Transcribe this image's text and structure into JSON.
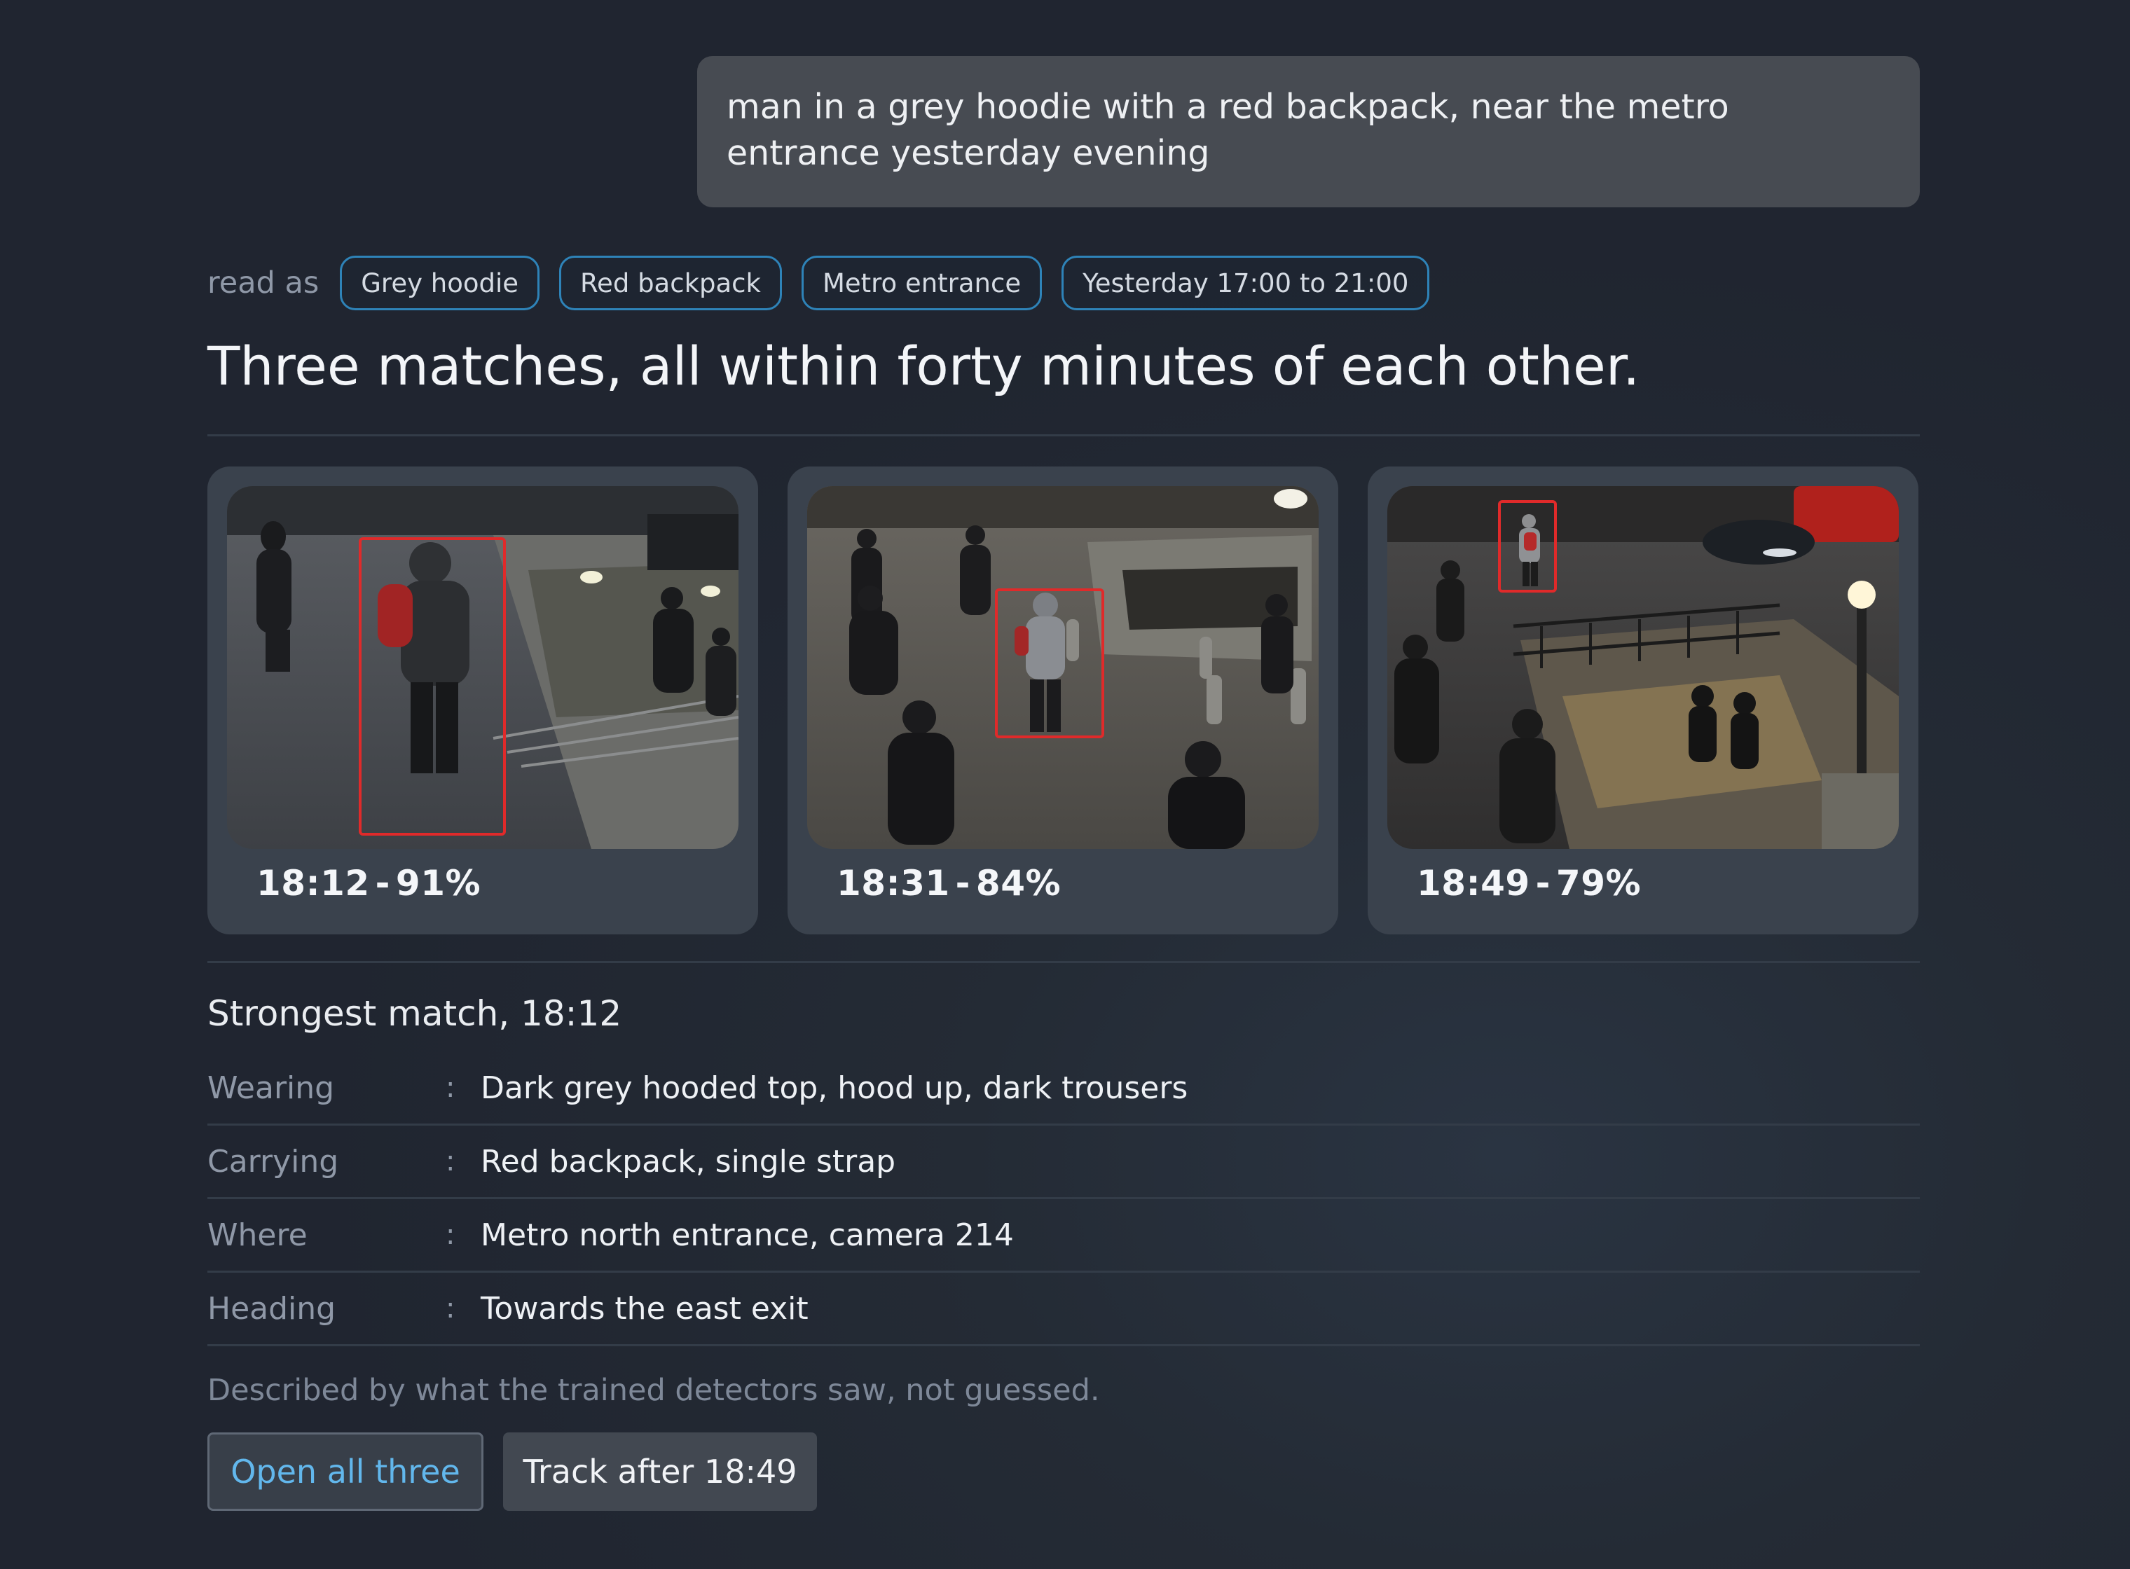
{
  "query": {
    "text": "man in a grey hoodie with a red backpack, near the metro entrance yesterday evening"
  },
  "interpretation": {
    "label": "read as",
    "chips": [
      "Grey hoodie",
      "Red backpack",
      "Metro entrance",
      "Yesterday 17:00 to 21:00"
    ]
  },
  "headline": "Three matches, all within forty minutes of each other.",
  "matches": [
    {
      "time": "18:12",
      "confidence": "91%"
    },
    {
      "time": "18:31",
      "confidence": "84%"
    },
    {
      "time": "18:49",
      "confidence": "79%"
    }
  ],
  "caption_separator": "-",
  "detail": {
    "title": "Strongest match, 18:12",
    "rows": [
      {
        "label": "Wearing",
        "value": "Dark grey hooded top, hood up, dark trousers"
      },
      {
        "label": "Carrying",
        "value": "Red backpack, single strap"
      },
      {
        "label": "Where",
        "value": "Metro north entrance, camera 214"
      },
      {
        "label": "Heading",
        "value": "Towards the east exit"
      }
    ],
    "separator": ":"
  },
  "footnote": "Described by what the trained detectors saw, not guessed.",
  "actions": {
    "open_label": "Open all three",
    "track_label": "Track after 18:49"
  },
  "colors": {
    "accent": "#2e83b8",
    "link": "#62b7ec",
    "detection_box": "#e02a2a"
  }
}
